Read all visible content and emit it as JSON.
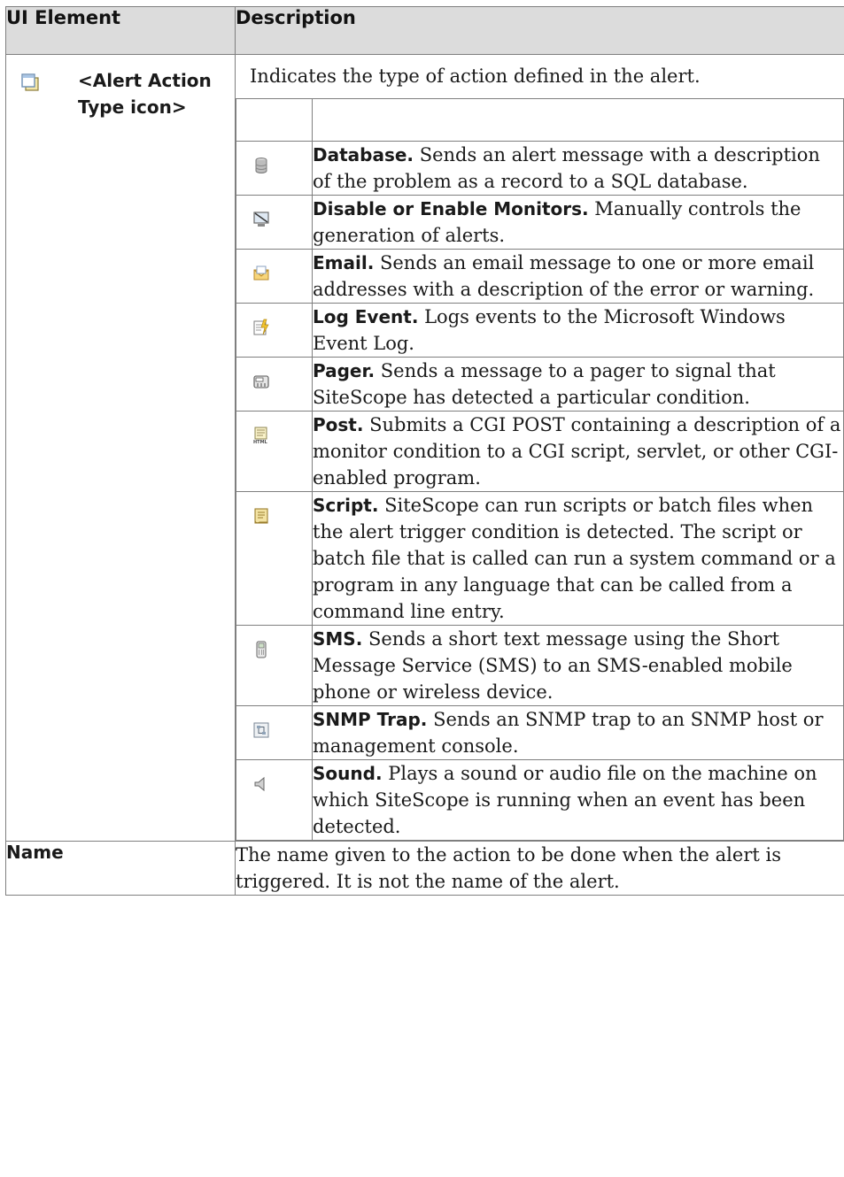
{
  "header": {
    "col_element": "UI Element",
    "col_description": "Description"
  },
  "rows": {
    "alert_action": {
      "element_label": "<Alert Action Type icon>",
      "description": "Indicates the type of action defined in the alert.",
      "items": [
        {
          "icon": "database-icon",
          "term": "Database.",
          "text": " Sends an alert message with a description of the problem as a record to a SQL database."
        },
        {
          "icon": "disable-enable-monitors-icon",
          "term": "Disable or Enable Monitors.",
          "text": " Manually controls the generation of alerts."
        },
        {
          "icon": "email-icon",
          "term": "Email.",
          "text": " Sends an email message to one or more email addresses with a description of the error or warning."
        },
        {
          "icon": "log-event-icon",
          "term": "Log Event.",
          "text": " Logs events to the Microsoft Windows Event Log."
        },
        {
          "icon": "pager-icon",
          "term": "Pager.",
          "text": " Sends a message to a pager to signal that SiteScope has detected a particular condition."
        },
        {
          "icon": "post-html-icon",
          "term": "Post.",
          "text": " Submits a CGI POST containing a description of a monitor condition to a CGI script, servlet, or other CGI-enabled program."
        },
        {
          "icon": "script-icon",
          "term": "Script.",
          "text": " SiteScope can run scripts or batch files when the alert trigger condition is detected. The script or batch file that is called can run a system command or a program in any language that can be called from a command line entry."
        },
        {
          "icon": "sms-icon",
          "term": "SMS.",
          "text": " Sends a short text message using the Short Message Service (SMS) to an SMS-enabled mobile phone or wireless device."
        },
        {
          "icon": "snmp-trap-icon",
          "term": "SNMP Trap.",
          "text": " Sends an SNMP trap to an SNMP host or management console."
        },
        {
          "icon": "sound-icon",
          "term": "Sound.",
          "text": " Plays a sound or audio file on the machine on which SiteScope is running when an event has been detected."
        }
      ]
    },
    "name": {
      "element_label": "Name",
      "description": "The name given to the action to be done when the alert is triggered. It is not the name of the alert."
    }
  }
}
